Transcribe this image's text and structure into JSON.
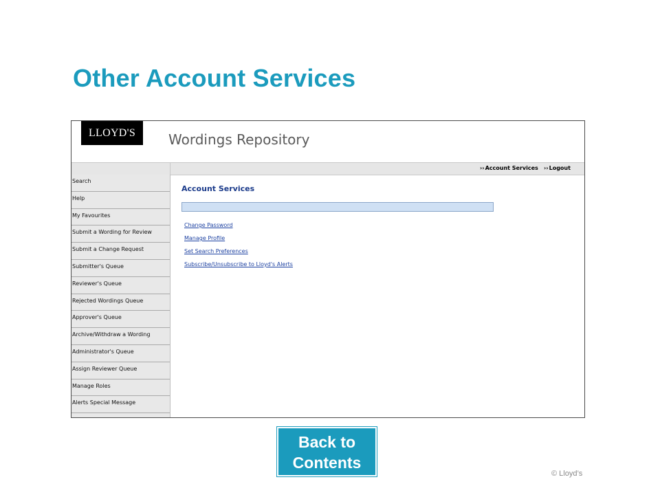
{
  "slide": {
    "title": "Other Account Services",
    "back_button": "Back to Contents",
    "copyright": "© Lloyd’s"
  },
  "app": {
    "logo_text": "LLOYD'S",
    "title": "Wordings Repository",
    "nav": [
      {
        "label": "Account Services",
        "arrows": "››"
      },
      {
        "label": "Logout",
        "arrows": "››"
      }
    ],
    "sidebar": [
      {
        "label": "Search"
      },
      {
        "label": "Help"
      },
      {
        "label": "My Favourites"
      },
      {
        "label": "Submit a Wording for Review"
      },
      {
        "label": "Submit a Change Request"
      },
      {
        "label": "Submitter's Queue"
      },
      {
        "label": "Reviewer's Queue"
      },
      {
        "label": "Rejected Wordings Queue"
      },
      {
        "label": "Approver's Queue"
      },
      {
        "label": "Archive/Withdraw a Wording"
      },
      {
        "label": "Administrator's Queue"
      },
      {
        "label": "Assign Reviewer Queue"
      },
      {
        "label": "Manage Roles"
      },
      {
        "label": "Alerts Special Message"
      }
    ],
    "content": {
      "heading": "Account Services",
      "links": [
        {
          "label": "Change Password"
        },
        {
          "label": "Manage Profile"
        },
        {
          "label": "Set Search Preferences"
        },
        {
          "label": "Subscribe/Unsubscribe to Lloyd's Alerts"
        }
      ]
    }
  },
  "colors": {
    "title": "#1b9bbd",
    "button_bg": "#1b9bbd",
    "link": "#1a3fa0",
    "heading": "#1a3a8a"
  }
}
